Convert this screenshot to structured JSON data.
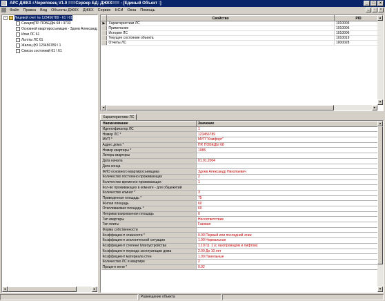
{
  "window": {
    "title": "АРС ДЖКХ г.Череповец V1.0 ===Сервер БД: ДЖКХ=== - [Единый Объект :]",
    "controls": [
      "_",
      "□",
      "×"
    ]
  },
  "menu": [
    "Файл",
    "Правка",
    "Вид",
    "Объекты ДЖКХ",
    "ДЖКХ",
    "Сервис",
    "НСИ",
    "Окна",
    "Помощь"
  ],
  "tree": {
    "nodes": [
      {
        "label": "Лицевой счет № 123456789 - 61 \\ 61",
        "level": 0,
        "expander": "-",
        "selected": true
      },
      {
        "label": "Секция(ПР. ПОБЕДЫ 68 \\ 3733",
        "level": 1
      },
      {
        "label": "Основной квартиросъемщик - Здоев Александр Н",
        "level": 1
      },
      {
        "label": "Иски ЛС 61",
        "level": 1
      },
      {
        "label": "Льготы ЛС 61",
        "level": 1
      },
      {
        "label": "Жилец (Ю 123456789 \\ 1",
        "level": 1
      },
      {
        "label": "Список состояний 61 \\ 61",
        "level": 1
      }
    ]
  },
  "upper_grid": {
    "headers": [
      "Свойство",
      "PID"
    ],
    "rows": [
      {
        "prop": "Характеристики ЛС",
        "pid": "1010003",
        "current": true
      },
      {
        "prop": "Примечание",
        "pid": "1010005"
      },
      {
        "prop": "История ЛС",
        "pid": "1010006"
      },
      {
        "prop": "Текущее состояние объекта",
        "pid": "1010019"
      },
      {
        "prop": "Отчеты ЛС",
        "pid": "1000028"
      }
    ]
  },
  "tab": {
    "label": "Характеристики ЛС"
  },
  "lower_grid": {
    "headers": [
      "Наименование",
      "Значение"
    ],
    "rows": [
      {
        "name": "Идентификатор ЛС",
        "value": "1"
      },
      {
        "name": "Номер ЛС *",
        "value": "123456789"
      },
      {
        "name": "МУП *",
        "value": "МУП \"Комфорт\""
      },
      {
        "name": "Адрес дома *",
        "value": "ПР. ПОБЕДЫ 68"
      },
      {
        "name": "Номер квартиры *",
        "value": "1085"
      },
      {
        "name": "Литера квартиры",
        "value": ""
      },
      {
        "name": "Дата начала",
        "value": "01.01.2004"
      },
      {
        "name": "Дата конца",
        "value": ""
      },
      {
        "name": "ФИО основного квартиросъемщика",
        "value": "Здоев Александр Николаевич"
      },
      {
        "name": "Количество постоянно проживающих",
        "value": "2"
      },
      {
        "name": "Количество временно проживающих",
        "value": "1"
      },
      {
        "name": "Кол-во проживающих в комнате - для общежитий",
        "value": ""
      },
      {
        "name": "Количество комнат *",
        "value": "3"
      },
      {
        "name": "Приведенная площадь *",
        "value": "75"
      },
      {
        "name": "Жилая площадь",
        "value": "60"
      },
      {
        "name": "Отапливаемая площадь *",
        "value": "60"
      },
      {
        "name": "Неприватизированная площадь",
        "value": "0"
      },
      {
        "name": "Тип квартиры",
        "value": "Несоответствие"
      },
      {
        "name": "Тип плиты",
        "value": "Газовая"
      },
      {
        "name": "Форма собственности",
        "value": ""
      },
      {
        "name": "Коэффициент этажности *",
        "value": "0.00 Первый или последний этаж"
      },
      {
        "name": "Коэффициент экологической ситуации",
        "value": "1.00 Нормальная"
      },
      {
        "name": "Коэффициент степени благоустройства",
        "value": "1.10 Гр. 1 (с газопроводом и лифтом)"
      },
      {
        "name": "Коэффициент периода эксплуатации дома",
        "value": "2.00 До 10 лет"
      },
      {
        "name": "Коэффициент материала стен",
        "value": "1.00 Панельные"
      },
      {
        "name": "Количество ЛС в квартире",
        "value": "2"
      },
      {
        "name": "Процент пени *",
        "value": "0.02"
      }
    ]
  },
  "status": {
    "message": "Размещение объекта"
  }
}
